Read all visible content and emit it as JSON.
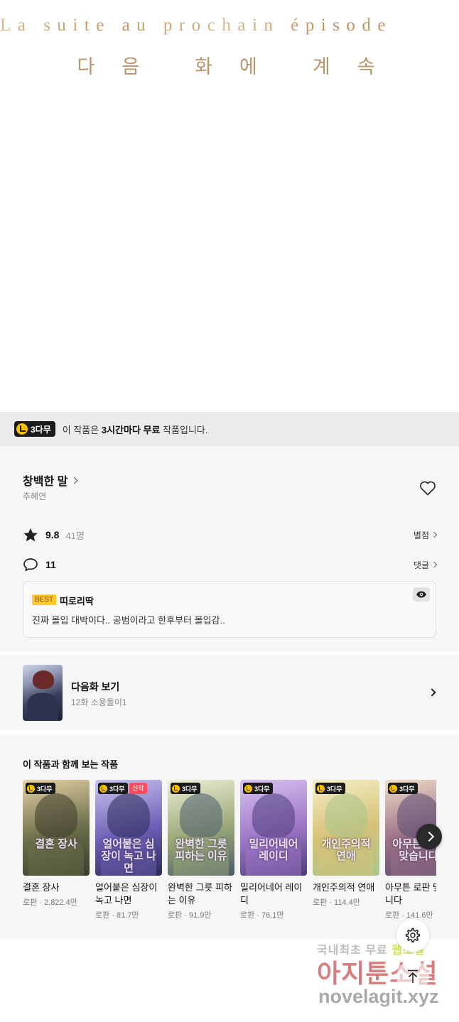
{
  "episode_end": {
    "french_line": "La suite au prochain épisode",
    "korean_chars": [
      "다",
      "음",
      "화",
      "에",
      "계",
      "속"
    ]
  },
  "notice": {
    "badge": "3다무",
    "text_prefix": "이 작품은 ",
    "text_bold": "3시간마다 무료",
    "text_suffix": " 작품입니다."
  },
  "work": {
    "title": "창백한 말",
    "author": "추혜연",
    "favorite_icon": "heart-icon"
  },
  "rating": {
    "value": "9.8",
    "count": "41명",
    "link": "별점",
    "icon": "star-icon"
  },
  "comments": {
    "count": "11",
    "link": "댓글",
    "icon": "speech-bubble-icon"
  },
  "best_comment": {
    "tag": "BEST",
    "author": "띠로리딱",
    "text": "진짜 몰입 대박이다.. 공범이라고 한후부터 몰입감..",
    "toggle_icon": "eye-icon"
  },
  "next_episode": {
    "title": "다음화 보기",
    "subtitle": "12화 소용돌이1"
  },
  "recommendations": {
    "heading": "이 작품과 함께 보는 작품",
    "items": [
      {
        "cover_text": "결혼 장사",
        "name": "결혼 장사",
        "meta": "로판 · 2,822.4만",
        "badge": "3다무",
        "new": "",
        "bg": [
          "#e9d2a6",
          "#6b6f4a",
          "#3b3b2c"
        ]
      },
      {
        "cover_text": "얼어붙은 심장이 녹고 나면",
        "name": "얼어붙은 심장이 녹고 나면",
        "meta": "로판 · 81.7만",
        "badge": "3다무",
        "new": "신작",
        "bg": [
          "#c9c6ef",
          "#6d5fb6",
          "#2c2a55"
        ]
      },
      {
        "cover_text": "완벽한 그릇 피하는 이유",
        "name": "완벽한 그릇 피하는 이유",
        "meta": "로판 · 91.9만",
        "badge": "3다무",
        "new": "",
        "bg": [
          "#eef0d8",
          "#9aa776",
          "#4a5b6c"
        ]
      },
      {
        "cover_text": "밀리어네어 레이디",
        "name": "밀리어네어 레이디",
        "meta": "로판 · 76.1만",
        "badge": "3다무",
        "new": "",
        "bg": [
          "#d9c4f0",
          "#9d76c6",
          "#4d3c7c"
        ]
      },
      {
        "cover_text": "개인주의적 연애",
        "name": "개인주의적 연애",
        "meta": "로판 · 114.4만",
        "badge": "3다무",
        "new": "",
        "bg": [
          "#f4efc6",
          "#d5c177",
          "#a8c58d"
        ]
      },
      {
        "cover_text": "아무튼 로판 맞습니다",
        "name": "아무튼 로판 맞습니다",
        "meta": "로판 · 141.6만",
        "badge": "3다무",
        "new": "",
        "bg": [
          "#f2ddc8",
          "#9a6f86",
          "#5a4a72"
        ]
      }
    ]
  },
  "watermark": {
    "line1_a": "국내최초 무료 ",
    "line1_b": "웹소설",
    "line2": "아지툰소설",
    "line3": "novelagit.xyz"
  }
}
